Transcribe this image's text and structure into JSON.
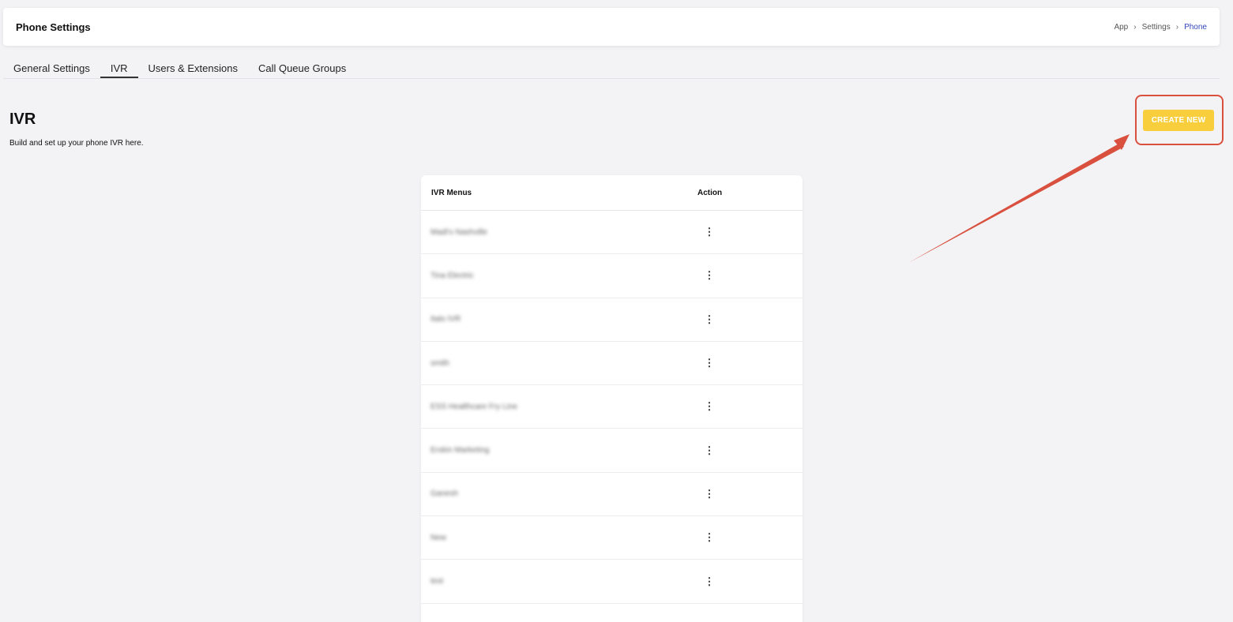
{
  "header": {
    "title": "Phone Settings",
    "breadcrumb": [
      "App",
      "Settings",
      "Phone"
    ]
  },
  "tabs": [
    {
      "label": "General Settings",
      "active": false
    },
    {
      "label": "IVR",
      "active": true
    },
    {
      "label": "Users & Extensions",
      "active": false
    },
    {
      "label": "Call Queue Groups",
      "active": false
    }
  ],
  "main": {
    "title": "IVR",
    "subtitle": "Build and set up your phone IVR here.",
    "create_button_label": "CREATE NEW"
  },
  "table": {
    "columns": [
      "IVR Menus",
      "Action"
    ],
    "rows": [
      {
        "name": "Madi's Nashville",
        "action_icon": "more-vertical-icon"
      },
      {
        "name": "Tina Electric",
        "action_icon": "more-vertical-icon"
      },
      {
        "name": "Italo IVR",
        "action_icon": "more-vertical-icon"
      },
      {
        "name": "smith",
        "action_icon": "more-vertical-icon"
      },
      {
        "name": "ESS Healthcare Fry Line",
        "action_icon": "more-vertical-icon"
      },
      {
        "name": "Erskin Marketing",
        "action_icon": "more-vertical-icon"
      },
      {
        "name": "Ganesh",
        "action_icon": "more-vertical-icon"
      },
      {
        "name": "New",
        "action_icon": "more-vertical-icon"
      },
      {
        "name": "test",
        "action_icon": "more-vertical-icon"
      }
    ]
  },
  "colors": {
    "accent": "#f9ce3c",
    "annotation": "#d9503f",
    "breadcrumb_current": "#3346b8",
    "background": "#f3f3f5"
  }
}
